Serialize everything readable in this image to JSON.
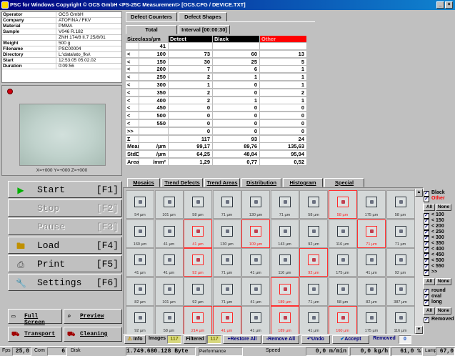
{
  "title": "PSC for Windows Copyright © OCS GmbH <PS-25C Measurement> [OCS.CFG / DEVICE.TXT]",
  "info": [
    {
      "label": "Operator",
      "value": "OCS GmbH"
    },
    {
      "label": "Company",
      "value": "ATOFINA / FKV"
    },
    {
      "label": "Material",
      "value": "PMMA"
    },
    {
      "label": "Sample",
      "value": "V046 R.182"
    },
    {
      "label": "",
      "value": "ZNH 174/8 II.7 25/8/01"
    },
    {
      "label": "Weight",
      "value": "500 g"
    },
    {
      "label": "Filename",
      "value": "PSC00004"
    },
    {
      "label": "Directory",
      "value": "L:\\data\\ato_fkv\\"
    },
    {
      "label": "Start",
      "value": "12:53:05  05.02.02"
    },
    {
      "label": "Duration",
      "value": "0:09:56"
    }
  ],
  "camera": {
    "coords": "X=+000  Y=+000  Z=+000"
  },
  "tabs": {
    "counters": "Defect Counters",
    "shapes": "Defect Shapes",
    "total": "Total",
    "interval": "Interval [00:00:30]"
  },
  "counter_table": {
    "headers": [
      "Sizeclass/µm",
      "Detect",
      "Black",
      "Other"
    ],
    "rows": [
      [
        "",
        "41",
        "",
        "",
        ""
      ],
      [
        "<",
        "100",
        "73",
        "60",
        "13"
      ],
      [
        "<",
        "150",
        "30",
        "25",
        "5"
      ],
      [
        "<",
        "200",
        "7",
        "6",
        "1"
      ],
      [
        "<",
        "250",
        "2",
        "1",
        "1"
      ],
      [
        "<",
        "300",
        "1",
        "0",
        "1"
      ],
      [
        "<",
        "350",
        "2",
        "0",
        "2"
      ],
      [
        "<",
        "400",
        "2",
        "1",
        "1"
      ],
      [
        "<",
        "450",
        "0",
        "0",
        "0"
      ],
      [
        "<",
        "500",
        "0",
        "0",
        "0"
      ],
      [
        "<",
        "550",
        "0",
        "0",
        "0"
      ],
      [
        ">>",
        "",
        "0",
        "0",
        "0"
      ],
      [
        "Σ",
        "",
        "117",
        "93",
        "24"
      ],
      [
        "Mean",
        "/µm",
        "99,17",
        "89,76",
        "135,63"
      ],
      [
        "StdDev",
        "/µm",
        "64,25",
        "48,84",
        "95,94"
      ],
      [
        "Area",
        "/mm²",
        "1,29",
        "0,77",
        "0,52"
      ]
    ]
  },
  "buttons": {
    "start": {
      "label": "Start",
      "key": "[F1]"
    },
    "stop": {
      "label": "Stop",
      "key": "[F2]"
    },
    "pause": {
      "label": "Pause",
      "key": "[F3]"
    },
    "load": {
      "label": "Load",
      "key": "[F4]"
    },
    "print": {
      "label": "Print",
      "key": "[F5]"
    },
    "settings": {
      "label": "Settings",
      "key": "[F6]"
    },
    "full_screen": "Full Screen",
    "preview": "Preview",
    "transport": "Transport",
    "cleaning": "Cleaning"
  },
  "view_tabs": [
    "Mosaics",
    "Trend Defects",
    "Trend Areas",
    "Distribution",
    "Histogram",
    "Special"
  ],
  "mosaic": {
    "rows": [
      [
        {
          "s": "54 µm",
          "h": false
        },
        {
          "s": "101 µm",
          "h": false
        },
        {
          "s": "58 µm",
          "h": false
        },
        {
          "s": "71 µm",
          "h": false
        },
        {
          "s": "130 µm",
          "h": false
        },
        {
          "s": "71 µm",
          "h": false
        },
        {
          "s": "58 µm",
          "h": false
        },
        {
          "s": "58 µm",
          "h": true
        },
        {
          "s": "175 µm",
          "h": false
        },
        {
          "s": "58 µm",
          "h": false
        }
      ],
      [
        {
          "s": "160 µm",
          "h": false
        },
        {
          "s": "41 µm",
          "h": false
        },
        {
          "s": "41 µm",
          "h": true
        },
        {
          "s": "130 µm",
          "h": false
        },
        {
          "s": "109 µm",
          "h": true
        },
        {
          "s": "143 µm",
          "h": false
        },
        {
          "s": "92 µm",
          "h": false
        },
        {
          "s": "116 µm",
          "h": false
        },
        {
          "s": "71 µm",
          "h": true
        },
        {
          "s": "71 µm",
          "h": false
        }
      ],
      [
        {
          "s": "41 µm",
          "h": false
        },
        {
          "s": "41 µm",
          "h": false
        },
        {
          "s": "92 µm",
          "h": true
        },
        {
          "s": "71 µm",
          "h": false
        },
        {
          "s": "41 µm",
          "h": false
        },
        {
          "s": "116 µm",
          "h": false
        },
        {
          "s": "92 µm",
          "h": true
        },
        {
          "s": "175 µm",
          "h": false
        },
        {
          "s": "41 µm",
          "h": false
        },
        {
          "s": "92 µm",
          "h": false
        }
      ],
      [
        {
          "s": "82 µm",
          "h": false
        },
        {
          "s": "101 µm",
          "h": false
        },
        {
          "s": "92 µm",
          "h": false
        },
        {
          "s": "71 µm",
          "h": false
        },
        {
          "s": "41 µm",
          "h": false
        },
        {
          "s": "189 µm",
          "h": true
        },
        {
          "s": "71 µm",
          "h": false
        },
        {
          "s": "58 µm",
          "h": false
        },
        {
          "s": "82 µm",
          "h": false
        },
        {
          "s": "387 µm",
          "h": false
        }
      ],
      [
        {
          "s": "92 µm",
          "h": false
        },
        {
          "s": "58 µm",
          "h": false
        },
        {
          "s": "214 µm",
          "h": true
        },
        {
          "s": "41 µm",
          "h": true
        },
        {
          "s": "41 µm",
          "h": false
        },
        {
          "s": "189 µm",
          "h": true
        },
        {
          "s": "41 µm",
          "h": false
        },
        {
          "s": "160 µm",
          "h": true
        },
        {
          "s": "175 µm",
          "h": false
        },
        {
          "s": "116 µm",
          "h": false
        }
      ]
    ]
  },
  "right_panel": {
    "black": "Black",
    "other": "Other",
    "all": "All",
    "none": "None",
    "sizes": [
      "100",
      "150",
      "200",
      "250",
      "300",
      "350",
      "400",
      "450",
      "500",
      "550",
      ">>"
    ],
    "shapes": [
      "round",
      "oval",
      "long"
    ],
    "removed": "Removed"
  },
  "bottom_bar": {
    "info": "Info",
    "images": "Images",
    "images_count": "117",
    "filtered": "Filtered",
    "filtered_count": "117",
    "restore_all": "+Restore All",
    "remove_all": "-Remove All",
    "undo": "Undo",
    "accept": "Accept",
    "removed": "Removed",
    "removed_count": "0"
  },
  "status": {
    "fps_label": "Fps",
    "fps": "25,0",
    "com_label": "Com",
    "com": "6",
    "disk_label": "Disk",
    "bytes": "1.749.680.128 Byte",
    "performance": "Performance",
    "speed_label": "Speed",
    "speed": "0,0 m/min",
    "throughput": "0,0 kg/h",
    "percent": "61,0 %",
    "lamp_label": "Lamp",
    "lamp": "67,0"
  },
  "colors": {
    "other": "#ff0000",
    "detect": "#000000",
    "black": "#000000",
    "highlight": "#ff3030"
  }
}
